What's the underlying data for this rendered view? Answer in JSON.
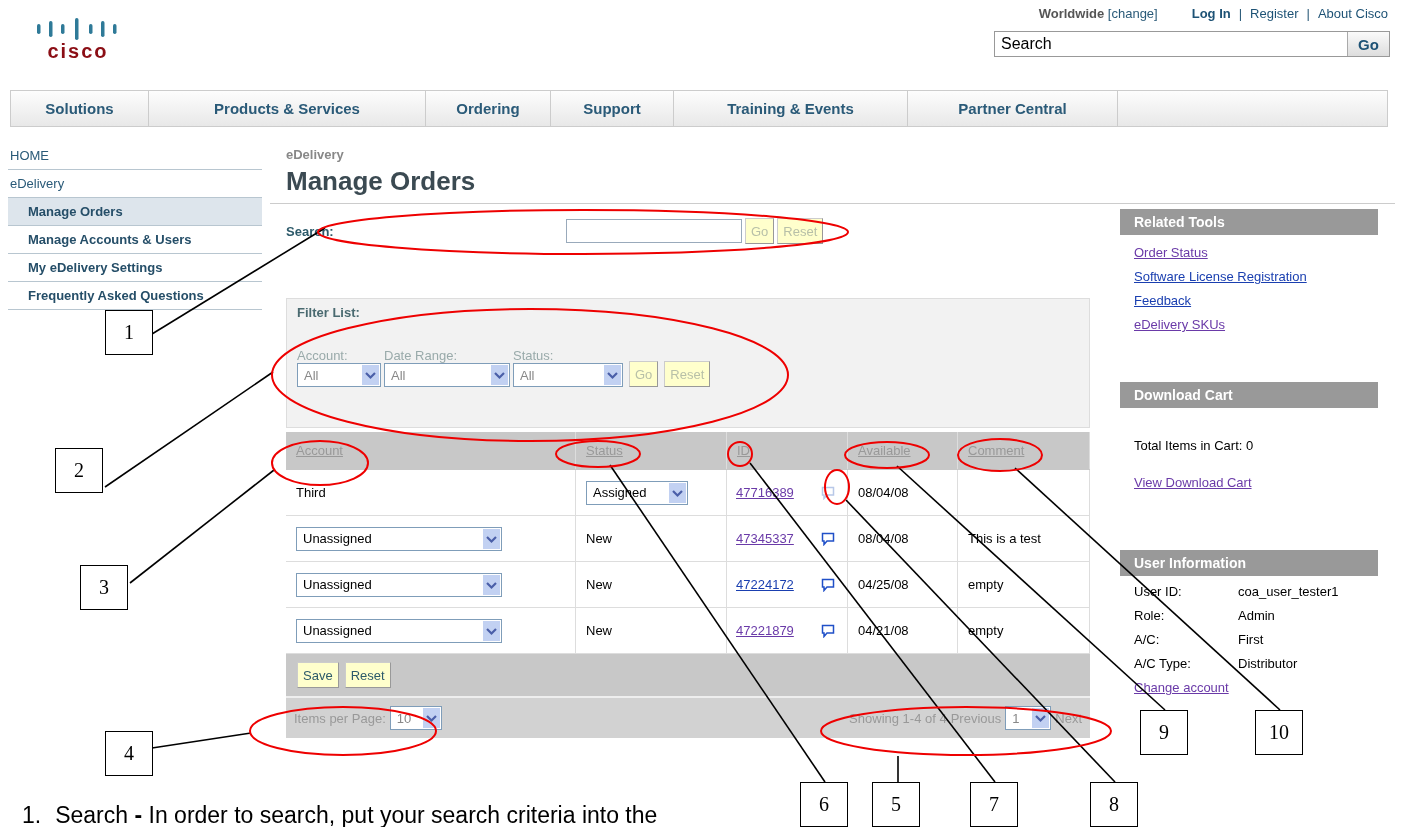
{
  "header": {
    "logo": "cisco",
    "region": "Worldwide",
    "region_change": "[change]",
    "top_links": [
      {
        "kind": "strong",
        "label": "Log In"
      },
      {
        "kind": "sep",
        "label": "|"
      },
      {
        "kind": "link",
        "label": "Register"
      },
      {
        "kind": "sep",
        "label": "|"
      },
      {
        "kind": "link",
        "label": "About Cisco"
      }
    ],
    "search": {
      "value": "Search",
      "button": "Go"
    }
  },
  "nav": [
    "Solutions",
    "Products & Services",
    "Ordering",
    "Support",
    "Training & Events",
    "Partner Central"
  ],
  "sidebar": {
    "items": [
      {
        "kind": "top",
        "label": "HOME",
        "selected": false
      },
      {
        "kind": "top",
        "label": "eDelivery",
        "selected": false
      },
      {
        "kind": "sub",
        "label": "Manage Orders",
        "selected": true
      },
      {
        "kind": "sub",
        "label": "Manage Accounts & Users",
        "selected": false
      },
      {
        "kind": "sub",
        "label": "My eDelivery Settings",
        "selected": false
      },
      {
        "kind": "sub",
        "label": "Frequently Asked Questions",
        "selected": false
      }
    ]
  },
  "main": {
    "breadcrumb": "eDelivery",
    "title": "Manage Orders",
    "search": {
      "label": "Search:",
      "buttons": [
        {
          "label": "Go",
          "disabled": true
        },
        {
          "label": "Reset",
          "disabled": true
        }
      ]
    },
    "filter": {
      "title": "Filter List:",
      "disabled": true,
      "fields": [
        {
          "label": "Account:",
          "value": "All"
        },
        {
          "label": "Date Range:",
          "value": "All"
        },
        {
          "label": "Status:",
          "value": "All"
        }
      ],
      "buttons": [
        "Go",
        "Reset"
      ]
    },
    "table": {
      "columns": [
        "Account",
        "Status",
        "ID",
        "Available",
        "Comment"
      ],
      "rows": [
        {
          "account": {
            "kind": "text",
            "value": "Third"
          },
          "status": {
            "kind": "select",
            "value": "Assigned"
          },
          "id": "47716389",
          "visited": true,
          "has_comment": false,
          "available": "08/04/08"
        },
        {
          "account": {
            "kind": "select",
            "value": "Unassigned"
          },
          "status": {
            "kind": "text",
            "value": "New"
          },
          "id": "47345337",
          "visited": true,
          "has_comment": true,
          "available": "08/04/08",
          "comment": "This is a test"
        },
        {
          "account": {
            "kind": "select",
            "value": "Unassigned"
          },
          "status": {
            "kind": "text",
            "value": "New"
          },
          "id": "47224172",
          "visited": false,
          "has_comment": true,
          "available": "04/25/08",
          "comment": "empty"
        },
        {
          "account": {
            "kind": "select",
            "value": "Unassigned"
          },
          "status": {
            "kind": "text",
            "value": "New"
          },
          "id": "47221879",
          "visited": true,
          "has_comment": true,
          "available": "04/21/08",
          "comment": "empty"
        }
      ],
      "actions": [
        "Save",
        "Reset"
      ],
      "pager": {
        "label": "Items per Page:",
        "per_page": "10",
        "showing": "Showing 1-4 of 4",
        "previous": "Previous",
        "page": "1",
        "next": "Next"
      }
    }
  },
  "right": {
    "related_tools": {
      "title": "Related Tools",
      "links": [
        {
          "label": "Order Status",
          "visited": true
        },
        {
          "label": "Software License Registration",
          "visited": false
        },
        {
          "label": "Feedback",
          "visited": false
        },
        {
          "label": "eDelivery SKUs",
          "visited": true
        }
      ]
    },
    "download_cart": {
      "title": "Download Cart",
      "total": "Total Items in Cart: 0",
      "link": "View Download Cart"
    },
    "user_info": {
      "title": "User Information",
      "fields": [
        {
          "label": "User ID:",
          "value": "coa_user_tester1"
        },
        {
          "label": "Role:",
          "value": "Admin"
        },
        {
          "label": "A/C:",
          "value": "First"
        },
        {
          "label": "A/C Type:",
          "value": "Distributor"
        }
      ],
      "link": "Change account"
    }
  },
  "footer_note": {
    "number": "1.",
    "text": "Search **-** In order to search, put your search criteria into the"
  },
  "callouts": [
    "1",
    "2",
    "3",
    "4",
    "6",
    "5",
    "7",
    "8",
    "9",
    "10"
  ]
}
